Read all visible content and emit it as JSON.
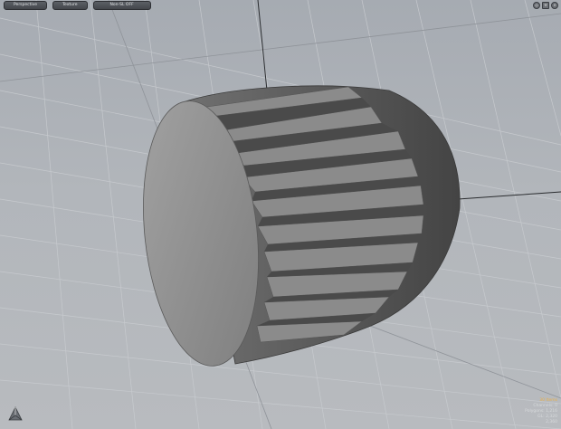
{
  "toolbar": {
    "view_mode": "Perspective",
    "shading": "Texture",
    "display": "Non-SL OFF"
  },
  "view_icons": [
    "◎",
    "⚒",
    "✕"
  ],
  "info_panel": {
    "selected": "30 Items",
    "line2": "Channels: 0",
    "line3": "Polygons: 1,216",
    "line4": "GL: 2,320",
    "line5": "2,360"
  },
  "colors": {
    "background": "#b2b6bb",
    "grid": "#c6c9cd",
    "cap": "#8e8e8e",
    "tooth": "#8a8a8a",
    "groove": "#4c4c4c",
    "accent": "#e8b04a"
  }
}
